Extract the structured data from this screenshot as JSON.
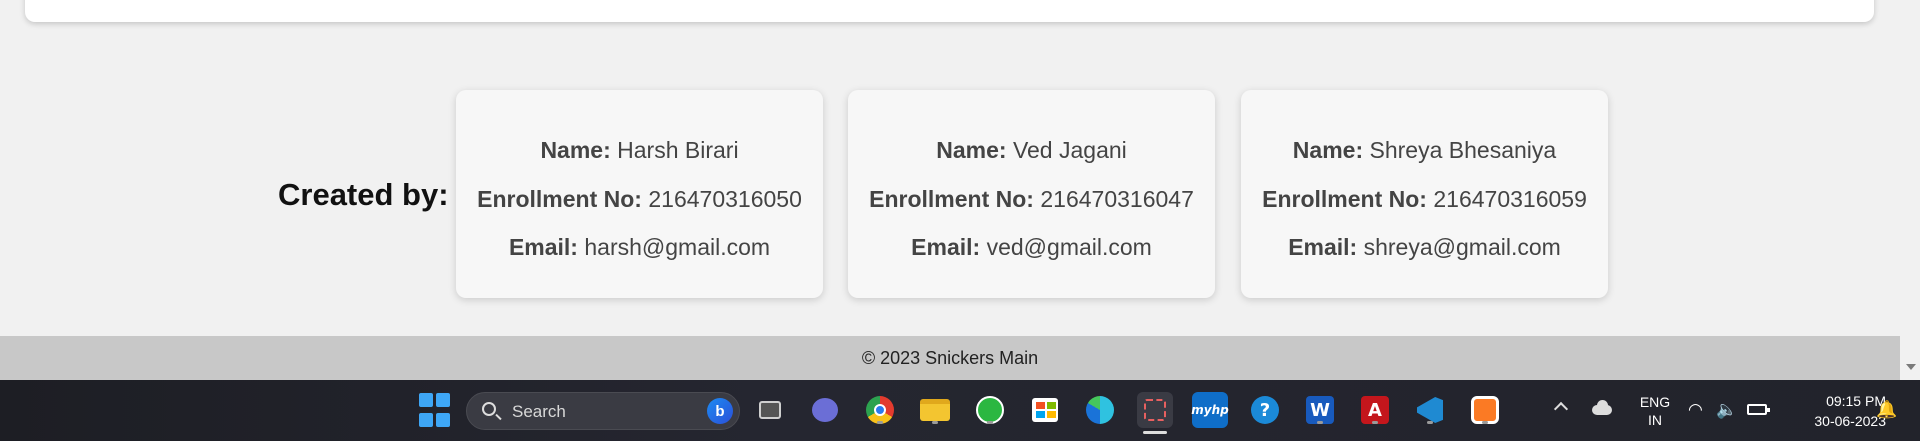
{
  "creators": {
    "label": "Created by:",
    "name_label": "Name:",
    "enrollment_label": "Enrollment No:",
    "email_label": "Email:",
    "people": [
      {
        "name": "Harsh Birari",
        "enrollment": "216470316050",
        "email": "harsh@gmail.com"
      },
      {
        "name": "Ved Jagani",
        "enrollment": "216470316047",
        "email": "ved@gmail.com"
      },
      {
        "name": "Shreya Bhesaniya",
        "enrollment": "216470316059",
        "email": "shreya@gmail.com"
      }
    ]
  },
  "footer": {
    "copyright": "© 2023 Snickers Main"
  },
  "taskbar": {
    "search_placeholder": "Search",
    "bing_glyph": "b",
    "apps": [
      "task-view",
      "teams-chat",
      "chrome",
      "file-explorer",
      "whatsapp",
      "microsoft-store",
      "edge",
      "snipping-tool",
      "myhp",
      "get-help",
      "word",
      "acrobat-reader",
      "vscode",
      "xampp"
    ],
    "app_glyphs": {
      "myhp": "myhp",
      "get-help": "?",
      "word": "W",
      "acrobat": "A"
    },
    "language": {
      "line1": "ENG",
      "line2": "IN"
    },
    "time": "09:15 PM",
    "date": "30-06-2023"
  }
}
